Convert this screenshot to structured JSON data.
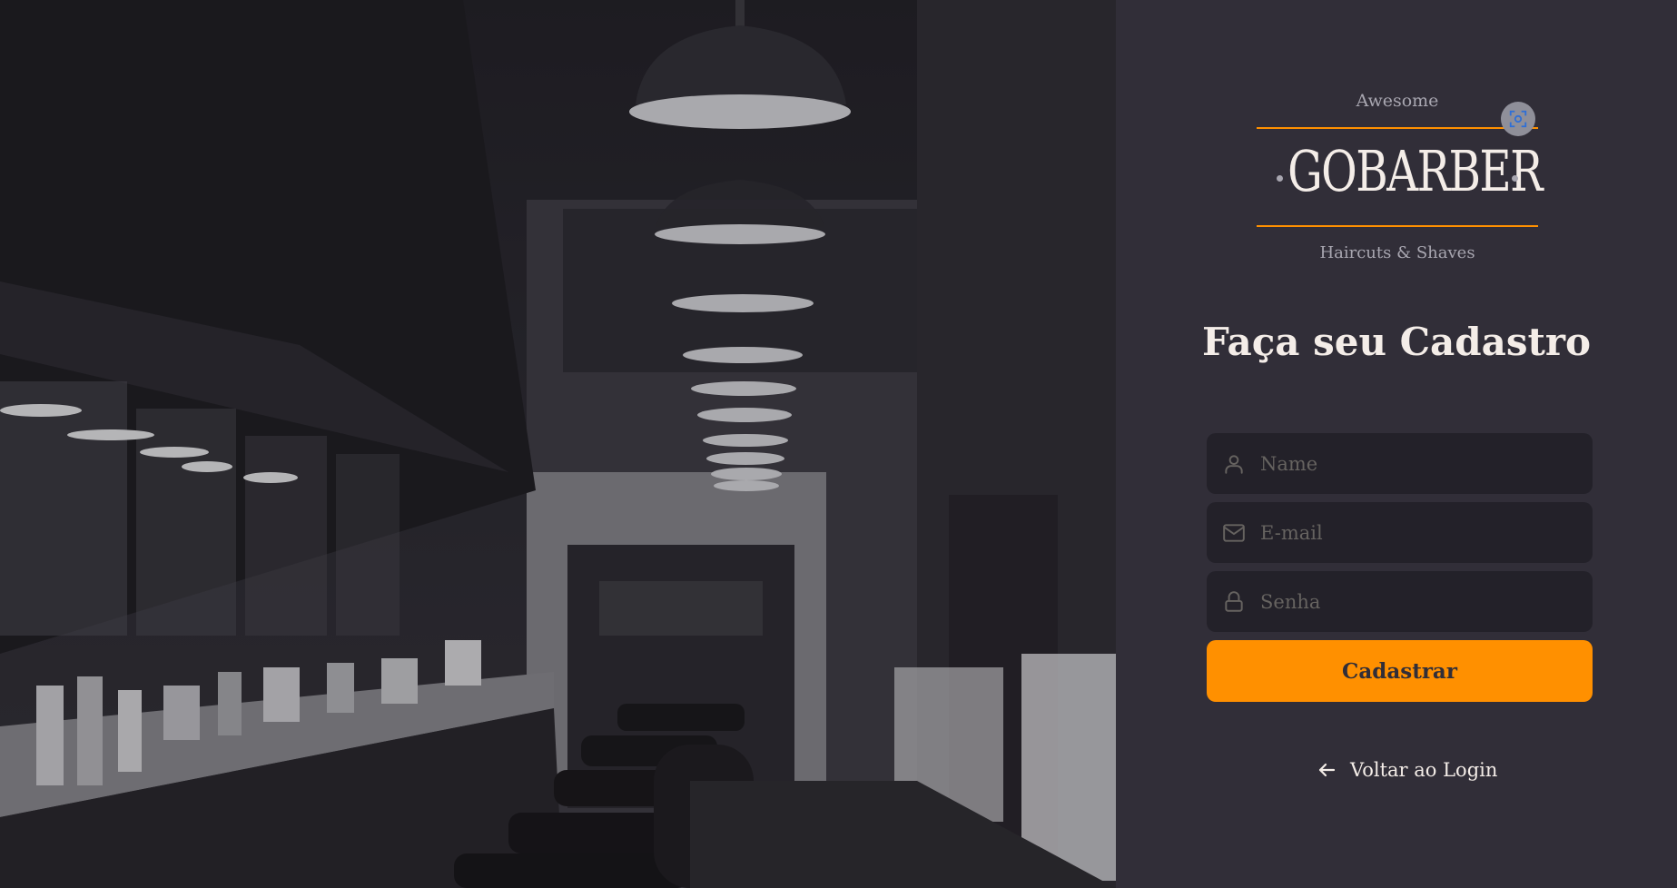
{
  "colors": {
    "background": "#312e38",
    "input_background": "#232129",
    "accent": "#ff9000",
    "text": "#f4ede8",
    "placeholder": "#666360"
  },
  "logo": {
    "top_text": "Awesome",
    "name": "GOBARBER",
    "bottom_text": "Haircuts & Shaves"
  },
  "form": {
    "title": "Faça seu Cadastro",
    "fields": [
      {
        "icon": "user-icon",
        "value": "",
        "placeholder": "Name"
      },
      {
        "icon": "mail-icon",
        "value": "",
        "placeholder": "E-mail"
      },
      {
        "icon": "lock-icon",
        "value": "",
        "placeholder": "Senha"
      }
    ],
    "submit_label": "Cadastrar"
  },
  "back_link": {
    "icon": "arrow-left-icon",
    "label": "Voltar ao Login"
  }
}
